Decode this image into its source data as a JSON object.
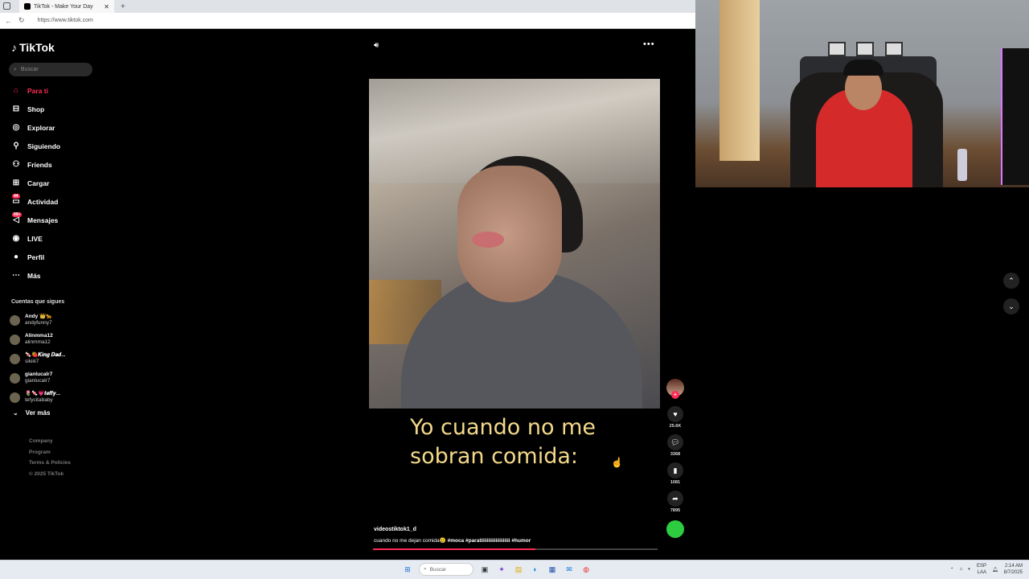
{
  "browser": {
    "tab_title": "TikTok - Make Your Day",
    "close": "✕",
    "new_tab": "+",
    "url": "https://www.tiktok.com"
  },
  "sidebar": {
    "logo": "TikTok",
    "search_placeholder": "Buscar",
    "items": [
      {
        "label": "Para ti",
        "icon": "home-icon",
        "glyph": "⌂",
        "active": true
      },
      {
        "label": "Shop",
        "icon": "shop-bag-icon",
        "glyph": "⊟"
      },
      {
        "label": "Explorar",
        "icon": "compass-icon",
        "glyph": "◎"
      },
      {
        "label": "Siguiendo",
        "icon": "following-icon",
        "glyph": "⚲"
      },
      {
        "label": "Friends",
        "icon": "friends-icon",
        "glyph": "⚇"
      },
      {
        "label": "Cargar",
        "icon": "upload-icon",
        "glyph": "⊞"
      },
      {
        "label": "Actividad",
        "icon": "activity-icon",
        "glyph": "▭",
        "badge": "44"
      },
      {
        "label": "Mensajes",
        "icon": "messages-icon",
        "glyph": "◁",
        "badge": "99+"
      },
      {
        "label": "LIVE",
        "icon": "live-icon",
        "glyph": "◉"
      },
      {
        "label": "Perfil",
        "icon": "profile-icon",
        "glyph": "●"
      },
      {
        "label": "Más",
        "icon": "more-icon",
        "glyph": "⋯"
      }
    ],
    "following_title": "Cuentas que sigues",
    "following": [
      {
        "display": "Andy 👑🐆",
        "handle": "andyfunny7"
      },
      {
        "display": "Alinmma12",
        "handle": "alinmma12"
      },
      {
        "display": "🍬🍓𝑲𝒊𝒏𝒈 𝑫𝒂𝒅...",
        "handle": "sikiiii7"
      },
      {
        "display": "gianlucalr7",
        "handle": "gianlucalr7"
      },
      {
        "display": "🌷🍬💗𝒕𝒆𝒇𝒇𝒚...",
        "handle": "tefycitababy"
      }
    ],
    "see_more": "Ver más",
    "footer": [
      "Company",
      "Program",
      "Terms & Policies",
      "© 2025 TikTok"
    ]
  },
  "player": {
    "caption_line1": "Yo cuando no me",
    "caption_line2": "sobran comida:",
    "author": "videostiktok1_d",
    "description": "cuando no me dejan comida😢",
    "tags": "#moca #paratiiiiiiiiiiiiiiiiiiii #humor",
    "progress": 0.57,
    "likes": "25.6K",
    "comments": "3368",
    "saves": "1081",
    "shares": "7895"
  },
  "taskbar": {
    "search_placeholder": "Buscar",
    "lang1": "ESP",
    "lang2": "LAA",
    "time": "2:14 AM",
    "date": "8/7/2025"
  },
  "colors": {
    "accent": "#fe2c55",
    "caption": "#f3d98a",
    "background": "#000000"
  }
}
